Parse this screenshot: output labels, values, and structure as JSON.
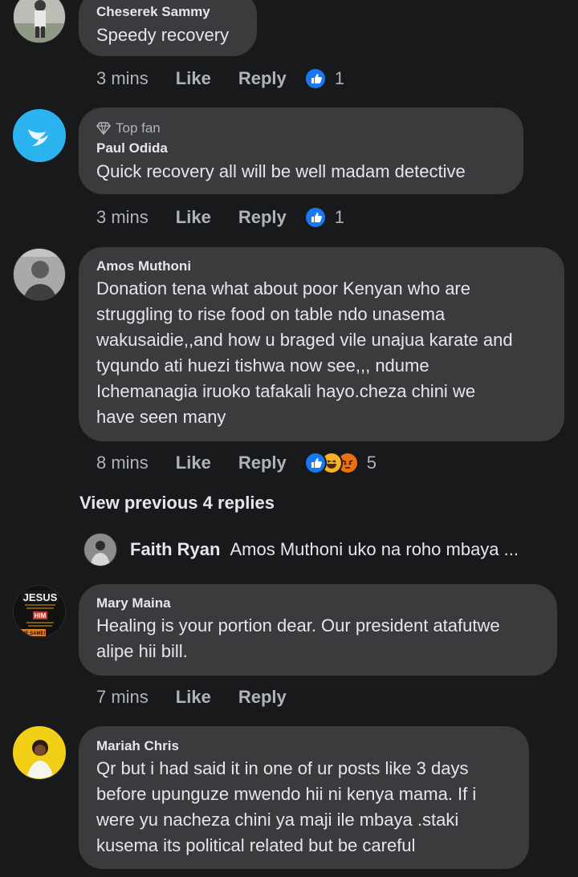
{
  "comments": [
    {
      "author": "Cheserek Sammy",
      "text": "Speedy recovery",
      "time": "3 mins",
      "like": "Like",
      "reply": "Reply",
      "reaction_count": "1"
    },
    {
      "badge": "Top fan",
      "author": "Paul Odida",
      "text": "Quick recovery all will be well madam detective",
      "time": "3 mins",
      "like": "Like",
      "reply": "Reply",
      "reaction_count": "1"
    },
    {
      "author": "Amos Muthoni",
      "lines": [
        "Donation tena what about poor Kenyan who are",
        "struggling to rise food on table ndo unasema",
        "wakusaidie,,and how u braged vile unajua karate and",
        "tyqundo ati huezi tishwa now see,,, ndume",
        "Ichemanagia iruoko tafakali hayo.cheza chini we",
        "have seen many"
      ],
      "time": "8 mins",
      "like": "Like",
      "reply": "Reply",
      "reaction_count": "5"
    },
    {
      "author": "Mary Maina",
      "lines": [
        "Healing is your portion dear. Our president atafutwe",
        "alipe hii bill."
      ],
      "time": "7 mins",
      "like": "Like",
      "reply": "Reply"
    },
    {
      "author": "Mariah Chris",
      "lines": [
        "Qr but i had said it in one of ur posts like 3 days",
        "before upunguze mwendo hii ni kenya mama. If i",
        "were yu nacheza chini ya maji ile mbaya .staki",
        "kusema its political related but be careful"
      ]
    }
  ],
  "view_previous": "View previous 4 replies",
  "reply_preview": {
    "author": "Faith Ryan",
    "text": "Amos Muthoni uko na roho mbaya ..."
  },
  "avatar_texts": {
    "jesus_top": "JESUS",
    "jesus_mid": "HIM",
    "jesus_bottom": "THE SAME!"
  },
  "colors": {
    "background": "#18191a",
    "bubble": "#3a3b3c",
    "primary_text": "#e4e6eb",
    "secondary_text": "#b0b3b8",
    "like_blue": "#1877f2"
  }
}
